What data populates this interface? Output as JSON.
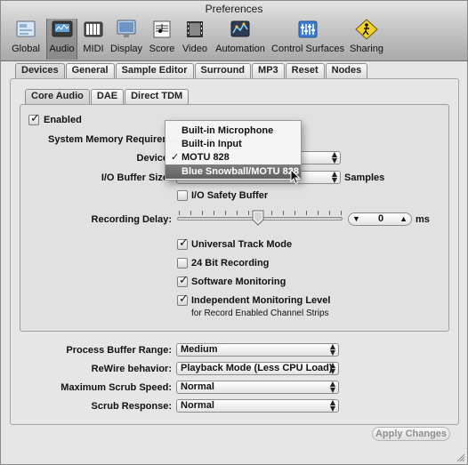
{
  "window": {
    "title": "Preferences"
  },
  "toolbar": {
    "items": [
      {
        "label": "Global",
        "icon": "global-icon"
      },
      {
        "label": "Audio",
        "icon": "audio-icon",
        "selected": true
      },
      {
        "label": "MIDI",
        "icon": "midi-icon"
      },
      {
        "label": "Display",
        "icon": "display-icon"
      },
      {
        "label": "Score",
        "icon": "score-icon"
      },
      {
        "label": "Video",
        "icon": "video-icon"
      },
      {
        "label": "Automation",
        "icon": "automation-icon"
      },
      {
        "label": "Control Surfaces",
        "icon": "control-surfaces-icon"
      },
      {
        "label": "Sharing",
        "icon": "sharing-icon"
      }
    ]
  },
  "tabs": [
    "Devices",
    "General",
    "Sample Editor",
    "Surround",
    "MP3",
    "Reset",
    "Nodes"
  ],
  "active_tab": "Devices",
  "subtabs": [
    "Core Audio",
    "DAE",
    "Direct TDM"
  ],
  "active_subtab": "Core Audio",
  "core_audio": {
    "enabled_label": "Enabled",
    "enabled_checked": true,
    "system_memory_label": "System Memory Requirement",
    "device_label": "Device",
    "io_buffer_label": "I/O Buffer Size",
    "io_buffer_unit": "Samples",
    "io_safety_label": "I/O Safety Buffer",
    "io_safety_checked": false,
    "recording_delay_label": "Recording Delay:",
    "recording_delay_value": "0",
    "recording_delay_unit": "ms",
    "universal_track_label": "Universal Track Mode",
    "universal_track_checked": true,
    "bit24_label": "24 Bit Recording",
    "bit24_checked": false,
    "software_monitoring_label": "Software Monitoring",
    "software_monitoring_checked": true,
    "independent_monitoring_label": "Independent Monitoring Level",
    "independent_monitoring_sub": "for Record Enabled Channel Strips",
    "independent_monitoring_checked": true
  },
  "device_menu": {
    "items": [
      {
        "label": "Built-in Microphone",
        "checked": false,
        "highlighted": false
      },
      {
        "label": "Built-in Input",
        "checked": false,
        "highlighted": false
      },
      {
        "label": "MOTU 828",
        "checked": true,
        "highlighted": false
      },
      {
        "label": "Blue Snowball/MOTU 828",
        "checked": false,
        "highlighted": true
      }
    ]
  },
  "general": {
    "process_buffer_label": "Process Buffer Range:",
    "process_buffer_value": "Medium",
    "rewire_label": "ReWire behavior:",
    "rewire_value": "Playback Mode (Less CPU Load)",
    "max_scrub_label": "Maximum Scrub Speed:",
    "max_scrub_value": "Normal",
    "scrub_response_label": "Scrub Response:",
    "scrub_response_value": "Normal"
  },
  "apply_label": "Apply Changes",
  "symbols": {
    "check": "✓",
    "popup_arrows": "▲\n▼"
  }
}
